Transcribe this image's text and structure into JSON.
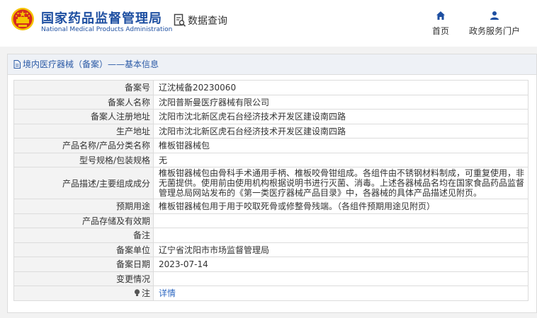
{
  "header": {
    "brand_cn": "国家药品监督管理局",
    "brand_en": "National Medical Products Administration",
    "data_query_label": "数据查询",
    "nav": [
      {
        "label": "首页",
        "icon": "home-icon"
      },
      {
        "label": "政务服务门户",
        "icon": "user-icon"
      }
    ]
  },
  "panel": {
    "title": "境内医疗器械（备案）——基本信息",
    "rows": [
      {
        "key": "备案号",
        "value": "辽沈械备20230060"
      },
      {
        "key": "备案人名称",
        "value": "沈阳普斯曼医疗器械有限公司"
      },
      {
        "key": "备案人注册地址",
        "value": "沈阳市沈北新区虎石台经济技术开发区建设南四路"
      },
      {
        "key": "生产地址",
        "value": "沈阳市沈北新区虎石台经济技术开发区建设南四路"
      },
      {
        "key": "产品名称/产品分类名称",
        "value": "椎板钳器械包"
      },
      {
        "key": "型号规格/包装规格",
        "value": "无"
      },
      {
        "key": "产品描述/主要组成成分",
        "value": "椎板钳器械包由骨科手术通用手柄、椎板咬骨钳组成。各组件由不锈钢材料制成，可重复使用，非无菌提供。使用前由使用机构根据说明书进行灭菌、消毒。上述各器械品名均在国家食品药品监督管理总局网站发布的《第一类医疗器械产品目录》中，各器械的具体产品描述见附页。"
      },
      {
        "key": "预期用途",
        "value": "椎板钳器械包用于用于咬取死骨或修整骨残端。（各组件预期用途见附页）"
      },
      {
        "key": "产品存储及有效期",
        "value": ""
      },
      {
        "key": "备注",
        "value": ""
      },
      {
        "key": "备案单位",
        "value": "辽宁省沈阳市市场监督管理局"
      },
      {
        "key": "备案日期",
        "value": "2023-07-14"
      },
      {
        "key": "变更情况",
        "value": ""
      },
      {
        "key": "注",
        "value": "详情"
      }
    ]
  },
  "colors": {
    "brand_blue": "#1e4fa1",
    "emblem_red": "#d52b1e",
    "emblem_gold": "#f5c400",
    "link_blue": "#2f69c2"
  }
}
